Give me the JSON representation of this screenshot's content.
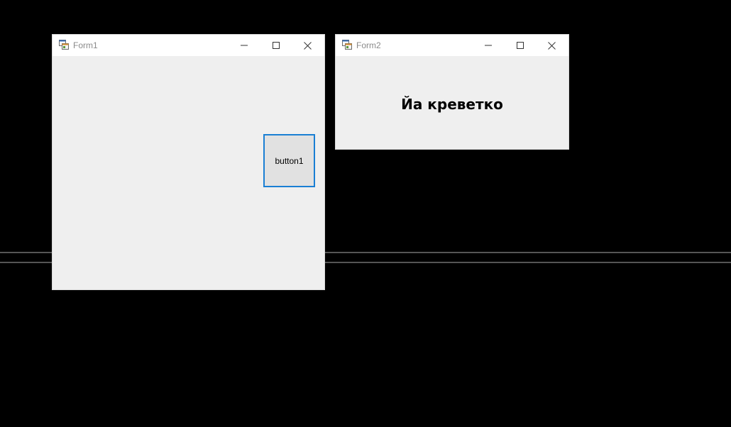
{
  "form1": {
    "title": "Form1",
    "button_label": "button1"
  },
  "form2": {
    "title": "Form2",
    "label_text": "Йа креветко"
  },
  "icons": {
    "app": "app-icon",
    "minimize": "minimize-icon",
    "maximize": "maximize-icon",
    "close": "close-icon"
  },
  "colors": {
    "desktop": "#000000",
    "window_client": "#efefef",
    "titlebar": "#ffffff",
    "button_focus_border": "#1a7fd4"
  }
}
